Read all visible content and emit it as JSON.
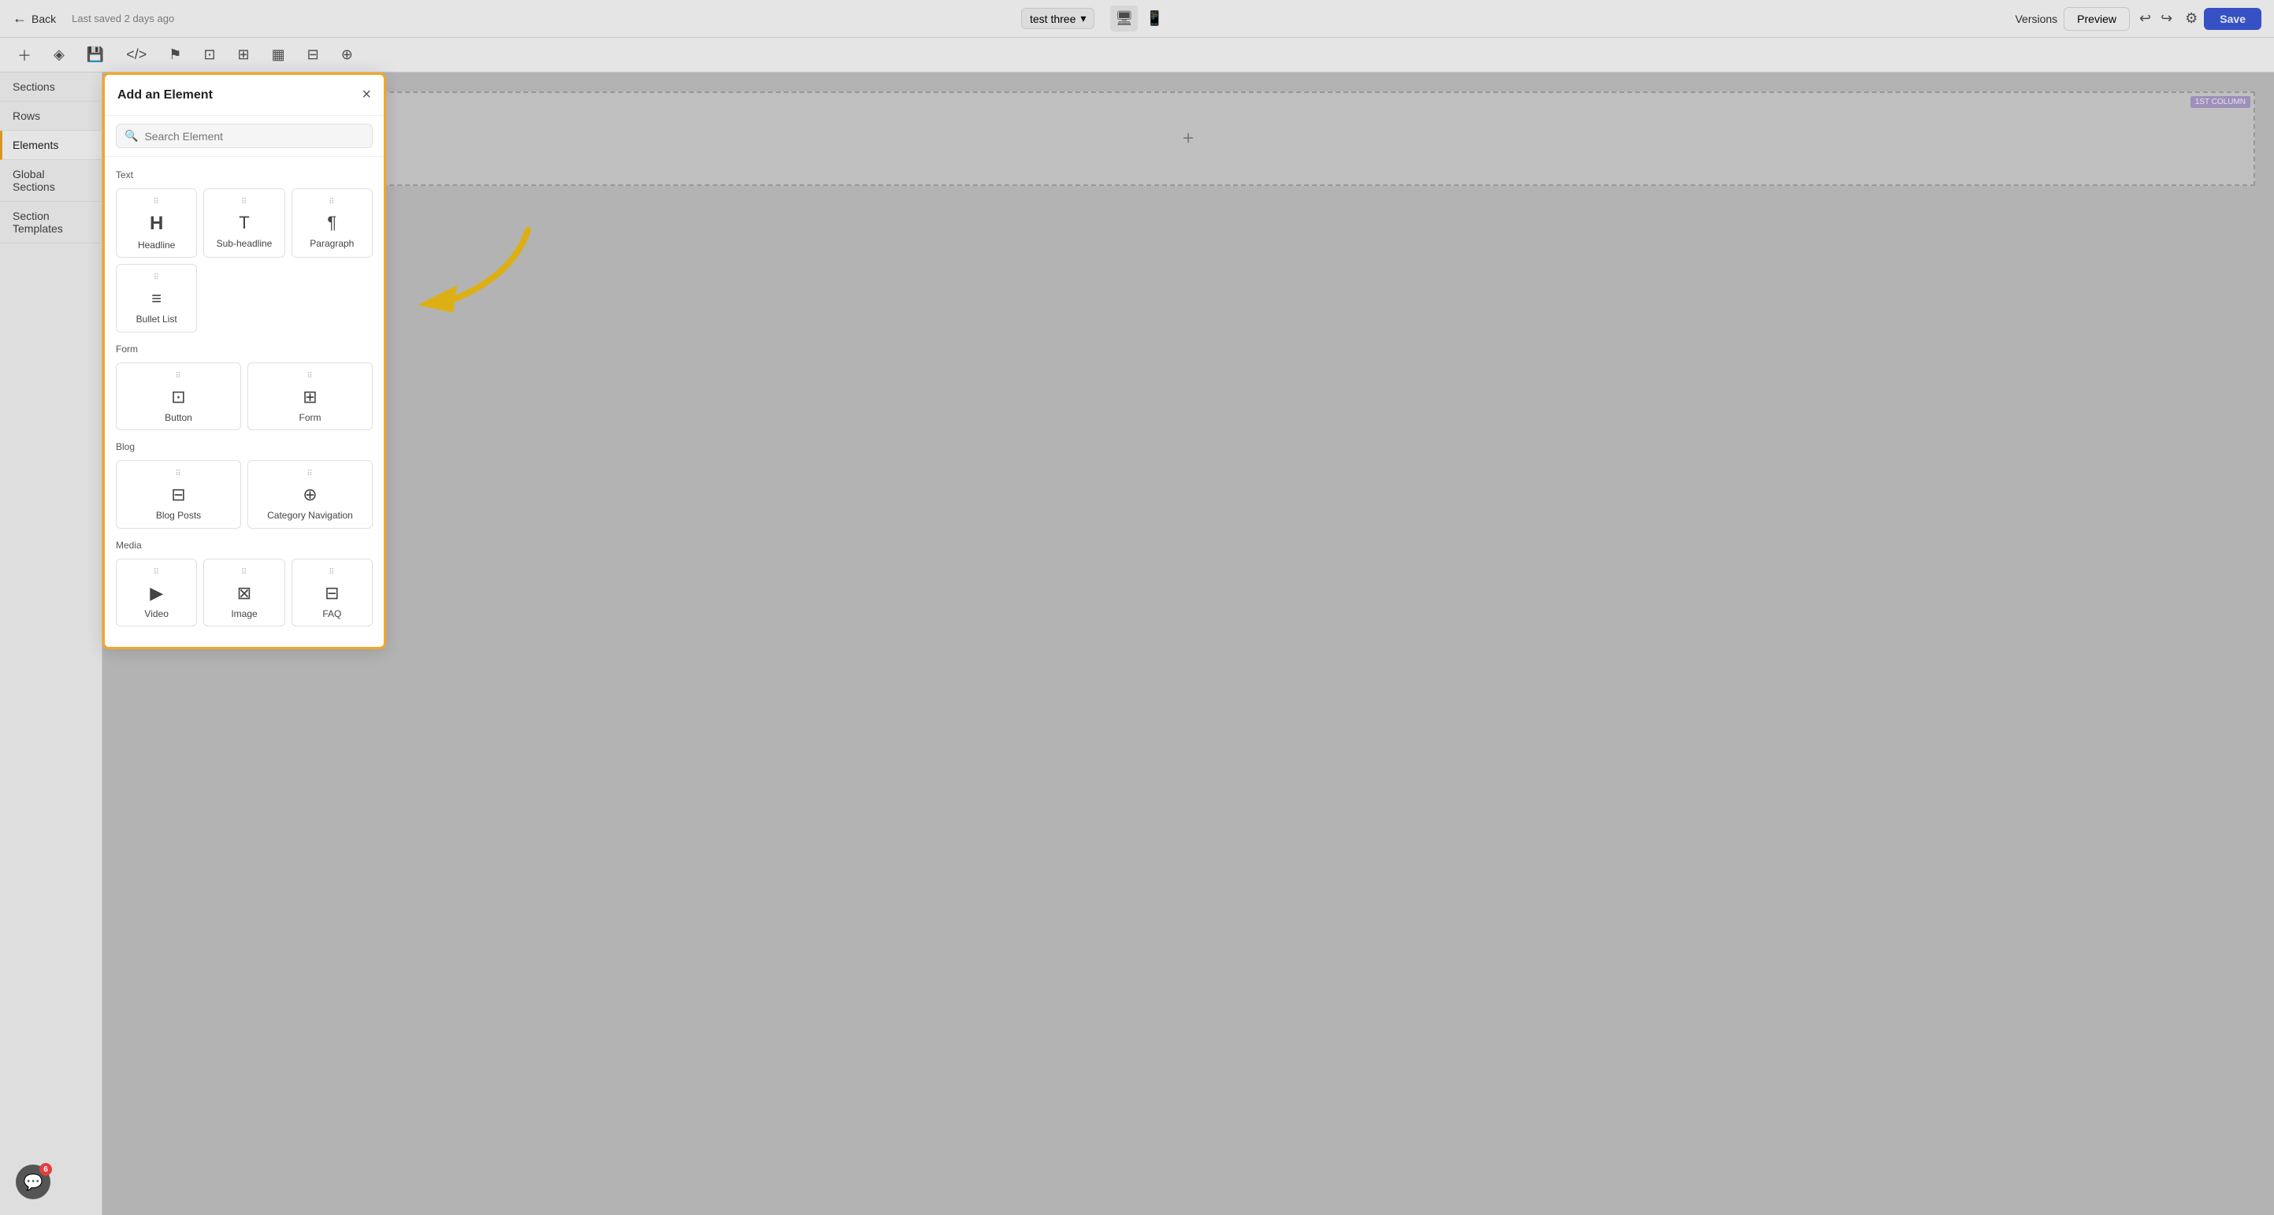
{
  "toolbar": {
    "back_label": "Back",
    "last_saved": "Last saved 2 days ago",
    "versions_label": "Versions",
    "preview_label": "Preview",
    "save_label": "Save",
    "page_name": "test three"
  },
  "sidebar": {
    "items": [
      {
        "id": "sections",
        "label": "Sections"
      },
      {
        "id": "rows",
        "label": "Rows"
      },
      {
        "id": "elements",
        "label": "Elements"
      },
      {
        "id": "global-sections",
        "label": "Global Sections"
      },
      {
        "id": "section-templates",
        "label": "Section Templates"
      }
    ],
    "active": "elements"
  },
  "modal": {
    "title": "Add an Element",
    "search_placeholder": "Search Element",
    "categories": [
      {
        "id": "text",
        "label": "Text",
        "items": [
          {
            "id": "headline",
            "label": "Headline",
            "icon": "H"
          },
          {
            "id": "sub-headline",
            "label": "Sub-headline",
            "icon": "T"
          },
          {
            "id": "paragraph",
            "label": "Paragraph",
            "icon": "¶"
          },
          {
            "id": "bullet-list",
            "label": "Bullet List",
            "icon": "≡"
          }
        ],
        "cols": 3
      },
      {
        "id": "form",
        "label": "Form",
        "items": [
          {
            "id": "button",
            "label": "Button",
            "icon": "⊡"
          },
          {
            "id": "form",
            "label": "Form",
            "icon": "⊞"
          }
        ],
        "cols": 2
      },
      {
        "id": "blog",
        "label": "Blog",
        "items": [
          {
            "id": "blog-posts",
            "label": "Blog Posts",
            "icon": "⊟"
          },
          {
            "id": "category-navigation",
            "label": "Category Navigation",
            "icon": "⊕"
          }
        ],
        "cols": 2
      },
      {
        "id": "media",
        "label": "Media",
        "items": [
          {
            "id": "video",
            "label": "Video",
            "icon": "▶"
          },
          {
            "id": "image",
            "label": "Image",
            "icon": "⊠"
          },
          {
            "id": "faq",
            "label": "FAQ",
            "icon": "⊟"
          }
        ],
        "cols": 3
      }
    ]
  },
  "canvas": {
    "column_label": "1ST COLUMN"
  },
  "chat": {
    "badge": "6"
  }
}
